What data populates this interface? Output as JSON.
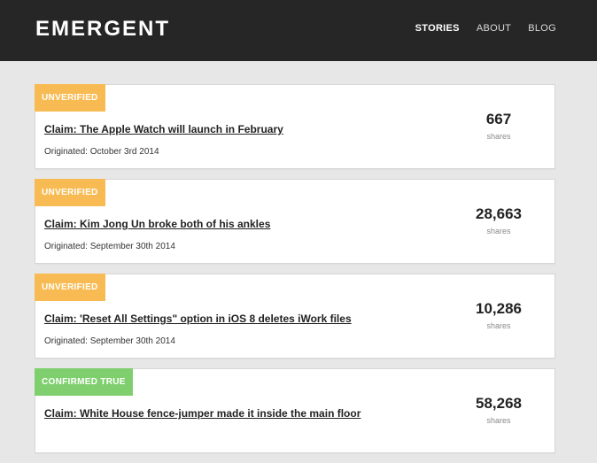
{
  "header": {
    "logo": "EMERGENT",
    "nav": [
      {
        "label": "STORIES"
      },
      {
        "label": "ABOUT"
      },
      {
        "label": "BLOG"
      }
    ]
  },
  "colors": {
    "unverified": "#f8bb53",
    "confirmed": "#7fcf6e"
  },
  "stories": [
    {
      "status": "UNVERIFIED",
      "status_kind": "unverified",
      "claim": "Claim: The Apple Watch will launch in February",
      "originated": "Originated: October 3rd 2014",
      "shares": "667",
      "shares_label": "shares"
    },
    {
      "status": "UNVERIFIED",
      "status_kind": "unverified",
      "claim": "Claim: Kim Jong Un broke both of his ankles",
      "originated": "Originated: September 30th 2014",
      "shares": "28,663",
      "shares_label": "shares"
    },
    {
      "status": "UNVERIFIED",
      "status_kind": "unverified",
      "claim": "Claim: 'Reset All Settings\" option in iOS 8 deletes iWork files",
      "originated": "Originated: September 30th 2014",
      "shares": "10,286",
      "shares_label": "shares"
    },
    {
      "status": "CONFIRMED TRUE",
      "status_kind": "confirmed",
      "claim": "Claim: White House fence-jumper made it inside the main floor",
      "originated": "",
      "shares": "58,268",
      "shares_label": "shares"
    }
  ]
}
